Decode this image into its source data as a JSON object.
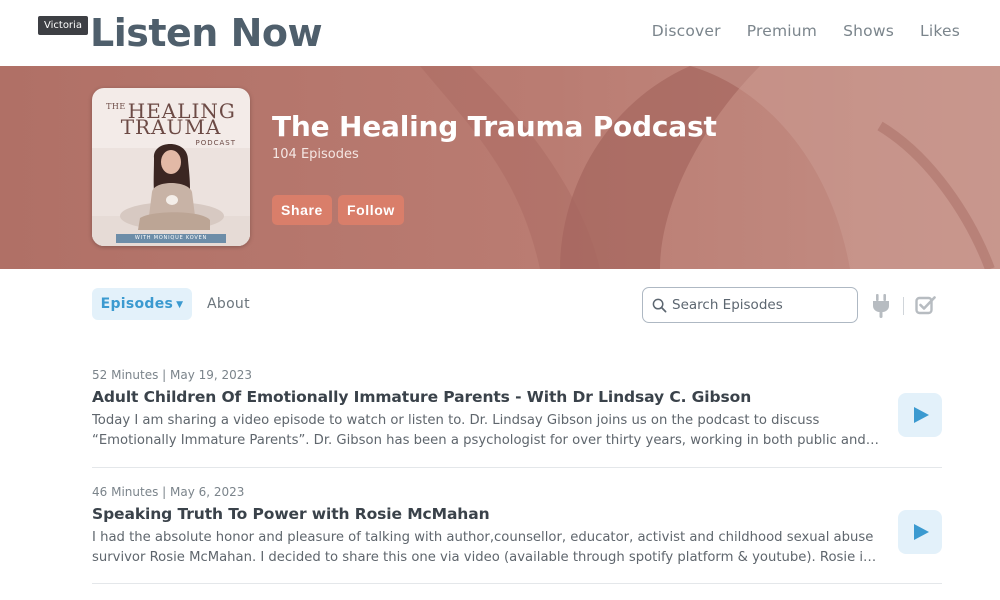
{
  "header": {
    "user_label": "Victoria",
    "title": "Listen Now",
    "nav": [
      "Discover",
      "Premium",
      "Shows",
      "Likes"
    ]
  },
  "podcast": {
    "cover": {
      "line1_prefix": "THE",
      "line1": "HEALING",
      "line2": "TRAUMA",
      "line3": "PODCAST",
      "strip": "WITH MONIQUE KOVEN"
    },
    "title": "The Healing Trauma Podcast",
    "episode_count": "104 Episodes",
    "share_label": "Share",
    "follow_label": "Follow",
    "hero_color": "#b5756c",
    "button_color": "#d97e6a"
  },
  "toolbar": {
    "episodes_tab": "Episodes",
    "about_tab": "About",
    "search_placeholder": "Search Episodes",
    "accent_color": "#3b9ad0"
  },
  "episodes": [
    {
      "meta": "52 Minutes | May 19, 2023",
      "title": "Adult Children Of Emotionally Immature Parents - With Dr Lindsay C. Gibson",
      "description": "Today I am sharing a video episode to watch or listen to. Dr. Lindsay Gibson joins us on the podcast to discuss “Emotionally Immature Parents”. Dr. Gibson has been a psychologist for over thirty years, working in both public and private practice. In th…"
    },
    {
      "meta": "46 Minutes | May 6, 2023",
      "title": "Speaking Truth To Power with Rosie McMahan",
      "description": "I had the absolute honor and pleasure of talking with author,counsellor, educator, activist and childhood sexual abuse survivor Rosie McMahan. I decided to share this one via video (available through spotify platform & youtube). Rosie is the author of…"
    }
  ],
  "icons": {
    "search": "search-icon",
    "plug": "plug-icon",
    "check": "check-square-icon",
    "play": "play-icon",
    "chevron": "chevron-down-icon"
  }
}
